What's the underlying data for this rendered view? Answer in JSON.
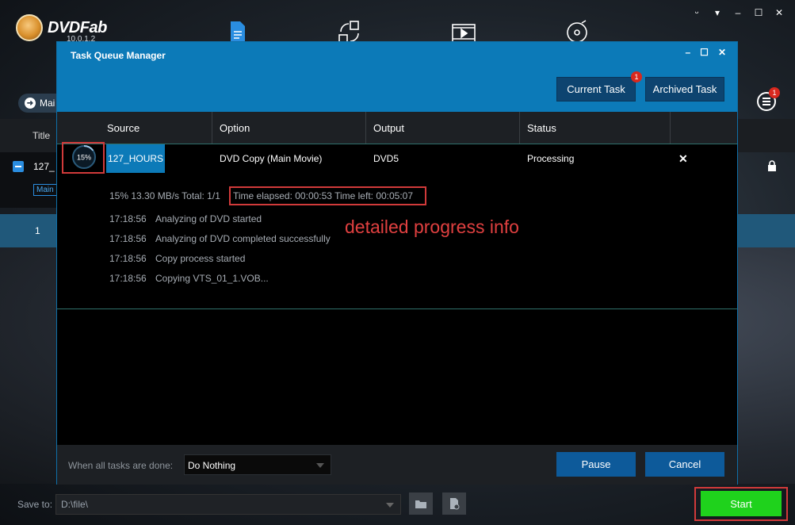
{
  "app": {
    "brand": "DVDFab",
    "version": "10.0.1.2",
    "main_button_label": "Mai",
    "left_column_header": "Title",
    "left_row_title": "127_",
    "left_row_tag": "Main",
    "left_row2_value": "1",
    "queue_badge": "1",
    "window_controls": [
      "ᵕ",
      "▾",
      "–",
      "☐",
      "✕"
    ],
    "icons": [
      "copy-icon",
      "converter-icon",
      "video-icon",
      "creator-icon"
    ]
  },
  "modal": {
    "title": "Task Queue Manager",
    "controls": [
      "–",
      "☐",
      "✕"
    ],
    "tabs": [
      {
        "label": "Current Task"
      },
      {
        "label": "Archived Task"
      }
    ],
    "current_task_badge": "1",
    "columns": [
      "Source",
      "Option",
      "Output",
      "Status"
    ],
    "task": {
      "progress_label": "15%",
      "progress": 0.15,
      "source": "127_HOURS",
      "option": "DVD Copy (Main Movie)",
      "output": "DVD5",
      "status": "Processing"
    },
    "detail": {
      "summary": "15%  13.30 MB/s  Total: 1/1",
      "time_info": "Time elapsed: 00:00:53  Time left: 00:05:07",
      "log": [
        {
          "time": "17:18:56",
          "message": "Analyzing of DVD started"
        },
        {
          "time": "17:18:56",
          "message": "Analyzing of DVD completed successfully"
        },
        {
          "time": "17:18:56",
          "message": "Copy process started"
        },
        {
          "time": "17:18:56",
          "message": "Copying VTS_01_1.VOB..."
        }
      ]
    },
    "annotation": "detailed progress info",
    "footer": {
      "when_done_label": "When all tasks are done:",
      "when_done_value": "Do Nothing",
      "pause_label": "Pause",
      "cancel_label": "Cancel"
    }
  },
  "bottom": {
    "save_to_label": "Save to:",
    "save_to_value": "D:\\file\\",
    "start_label": "Start"
  },
  "colors": {
    "accent": "#0c7ab8",
    "start": "#1fd21c",
    "highlight_box": "#d13a3a",
    "badge": "#d8281e"
  }
}
